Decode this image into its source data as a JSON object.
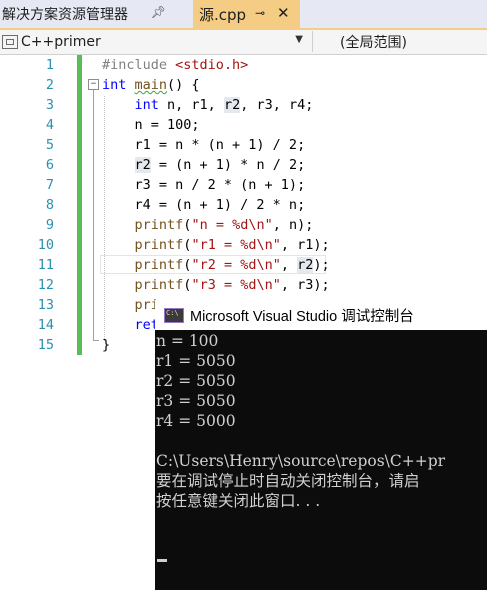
{
  "tabs": [
    {
      "label": "解决方案资源管理器",
      "pin_icon": "pin-icon",
      "active": false
    },
    {
      "label": "源.cpp",
      "pin_icon": "pin-icon",
      "close": "✕",
      "active": true
    }
  ],
  "navbar": {
    "project": "C++primer",
    "scope": "(全局范围)"
  },
  "editor": {
    "line_numbers": [
      "1",
      "2",
      "3",
      "4",
      "5",
      "6",
      "7",
      "8",
      "9",
      "10",
      "11",
      "12",
      "13",
      "14",
      "15"
    ],
    "current_line": "11",
    "lines": [
      "#include <stdio.h>",
      "int main() {",
      "    int n, r1, r2, r3, r4;",
      "    n = 100;",
      "    r1 = n * (n + 1) / 2;",
      "    r2 = (n + 1) * n / 2;",
      "    r3 = n / 2 * (n + 1);",
      "    r4 = (n + 1) / 2 * n;",
      "    printf(\"n = %d\\n\", n);",
      "    printf(\"r1 = %d\\n\", r1);",
      "    printf(\"r2 = %d\\n\", r2);",
      "    printf(\"r3 = %d\\n\", r3);",
      "    pri",
      "    ret",
      "}"
    ]
  },
  "console": {
    "title": "Microsoft Visual Studio 调试控制台",
    "lines": [
      "n = 100",
      "r1 = 5050",
      "r2 = 5050",
      "r3 = 5050",
      "r4 = 5000",
      "",
      "C:\\Users\\Henry\\source\\repos\\C++pr",
      "要在调试停止时自动关闭控制台，请启",
      "按任意键关闭此窗口. . ."
    ]
  },
  "colors": {
    "keyword": "#0000ff",
    "string": "#a31515",
    "preprocessor": "#808080",
    "line_number": "#2b91af",
    "active_tab": "#f5cc84",
    "change_bar": "#57bd57"
  }
}
